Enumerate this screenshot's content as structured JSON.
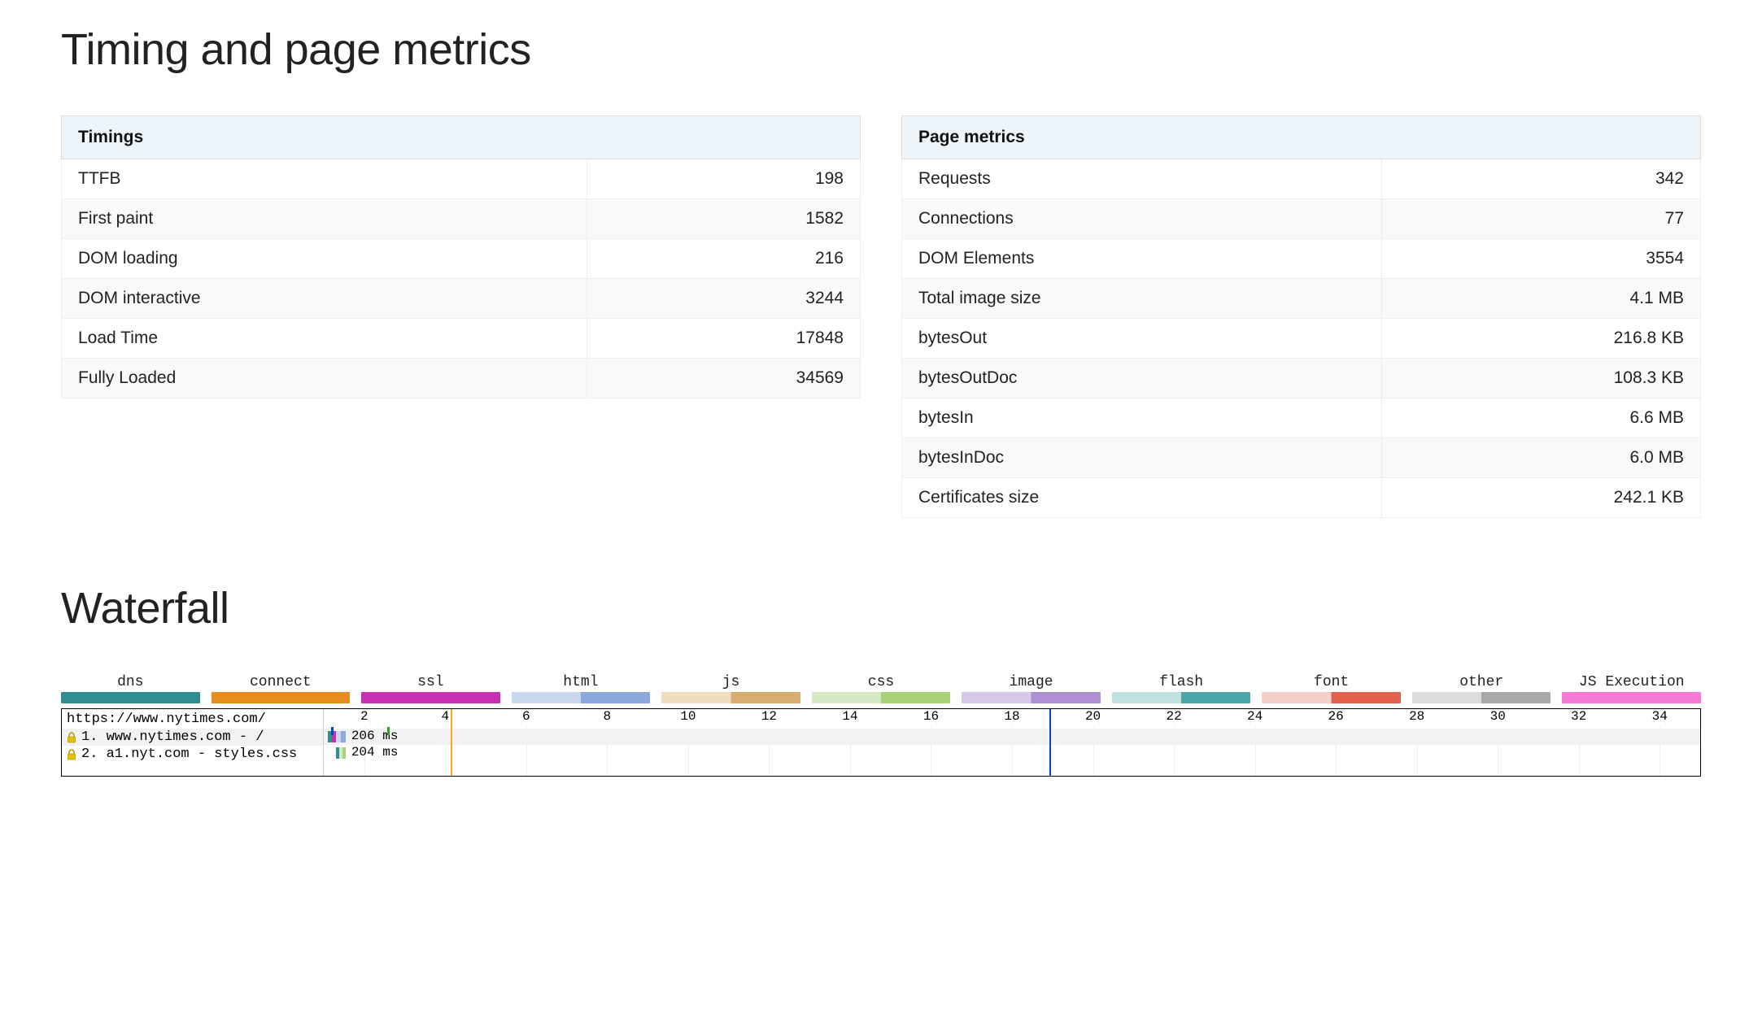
{
  "headings": {
    "main": "Timing and page metrics",
    "waterfall": "Waterfall"
  },
  "timings": {
    "header": "Timings",
    "rows": [
      {
        "label": "TTFB",
        "value": "198"
      },
      {
        "label": "First paint",
        "value": "1582"
      },
      {
        "label": "DOM loading",
        "value": "216"
      },
      {
        "label": "DOM interactive",
        "value": "3244"
      },
      {
        "label": "Load Time",
        "value": "17848"
      },
      {
        "label": "Fully Loaded",
        "value": "34569"
      }
    ]
  },
  "page_metrics": {
    "header": "Page metrics",
    "rows": [
      {
        "label": "Requests",
        "value": "342"
      },
      {
        "label": "Connections",
        "value": "77"
      },
      {
        "label": "DOM Elements",
        "value": "3554"
      },
      {
        "label": "Total image size",
        "value": "4.1 MB"
      },
      {
        "label": "bytesOut",
        "value": "216.8 KB"
      },
      {
        "label": "bytesOutDoc",
        "value": "108.3 KB"
      },
      {
        "label": "bytesIn",
        "value": "6.6 MB"
      },
      {
        "label": "bytesInDoc",
        "value": "6.0 MB"
      },
      {
        "label": "Certificates size",
        "value": "242.1 KB"
      }
    ]
  },
  "waterfall": {
    "legend": [
      {
        "label": "dns",
        "style": "solid",
        "light": "#4aa9a8",
        "dark": "#2e8f8e"
      },
      {
        "label": "connect",
        "style": "solid",
        "light": "#f4a33a",
        "dark": "#e78b1d"
      },
      {
        "label": "ssl",
        "style": "solid",
        "light": "#d545c4",
        "dark": "#c531b3"
      },
      {
        "label": "html",
        "style": "half",
        "light": "#c9d8ef",
        "dark": "#8ca8dd"
      },
      {
        "label": "js",
        "style": "half",
        "light": "#f1dcc0",
        "dark": "#d9ac72"
      },
      {
        "label": "css",
        "style": "half",
        "light": "#d7e9c4",
        "dark": "#a7d279"
      },
      {
        "label": "image",
        "style": "half",
        "light": "#d6c8e8",
        "dark": "#ad91d3"
      },
      {
        "label": "flash",
        "style": "half",
        "light": "#bfe2e0",
        "dark": "#4aa9a8"
      },
      {
        "label": "font",
        "style": "half",
        "light": "#f5cfc9",
        "dark": "#e2614c"
      },
      {
        "label": "other",
        "style": "half",
        "light": "#dcdcdc",
        "dark": "#a9a9a9"
      },
      {
        "label": "JS Execution",
        "style": "solid",
        "light": "#f99ee0",
        "dark": "#f67ad5"
      }
    ],
    "url": "https://www.nytimes.com/",
    "ticks": [
      "2",
      "4",
      "6",
      "8",
      "10",
      "12",
      "14",
      "16",
      "18",
      "20",
      "22",
      "24",
      "26",
      "28",
      "30",
      "32",
      "34"
    ],
    "rows": [
      {
        "num": "1.",
        "host": "www.nytimes.com",
        "path": "/",
        "ms": "206 ms"
      },
      {
        "num": "2.",
        "host": "a1.nyt.com",
        "path": "styles.css",
        "ms": "204 ms"
      }
    ],
    "markers": {
      "green_small_tick_pct": 4.6,
      "blue_small_tick_pct": 0.55,
      "orange_vline_pct": 9.2,
      "blue_vline_pct": 52.7
    }
  }
}
